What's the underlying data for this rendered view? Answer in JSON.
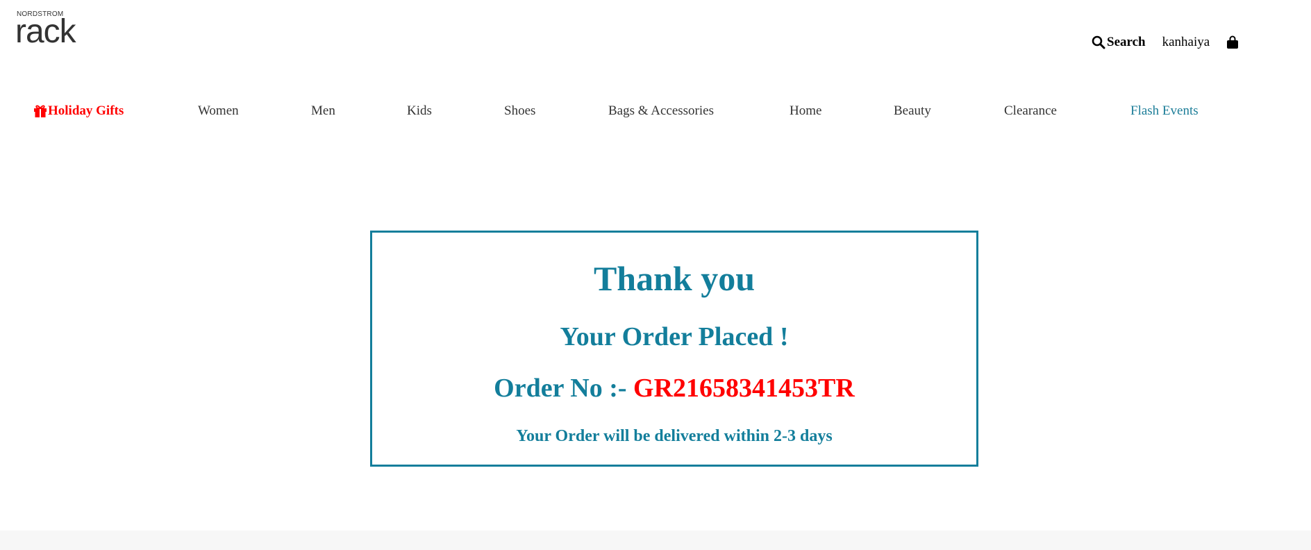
{
  "header": {
    "logo_small": "NORDSTROM",
    "logo_big": "rack",
    "search_label": "Search",
    "user_name": "kanhaiya"
  },
  "nav": {
    "items": [
      {
        "label": "Holiday Gifts"
      },
      {
        "label": "Women"
      },
      {
        "label": "Men"
      },
      {
        "label": "Kids"
      },
      {
        "label": "Shoes"
      },
      {
        "label": "Bags & Accessories"
      },
      {
        "label": "Home"
      },
      {
        "label": "Beauty"
      },
      {
        "label": "Clearance"
      },
      {
        "label": "Flash Events"
      }
    ]
  },
  "confirmation": {
    "title": "Thank you",
    "subtitle": "Your Order Placed !",
    "order_prefix": "Order No :- ",
    "order_number": "GR21658341453TR",
    "delivery_note": "Your Order will be delivered within 2-3 days"
  },
  "colors": {
    "accent": "#137e9b",
    "highlight": "#ff0000"
  },
  "icons": {
    "search": "search-icon",
    "bag": "shopping-bag-icon",
    "gift": "gift-icon"
  }
}
